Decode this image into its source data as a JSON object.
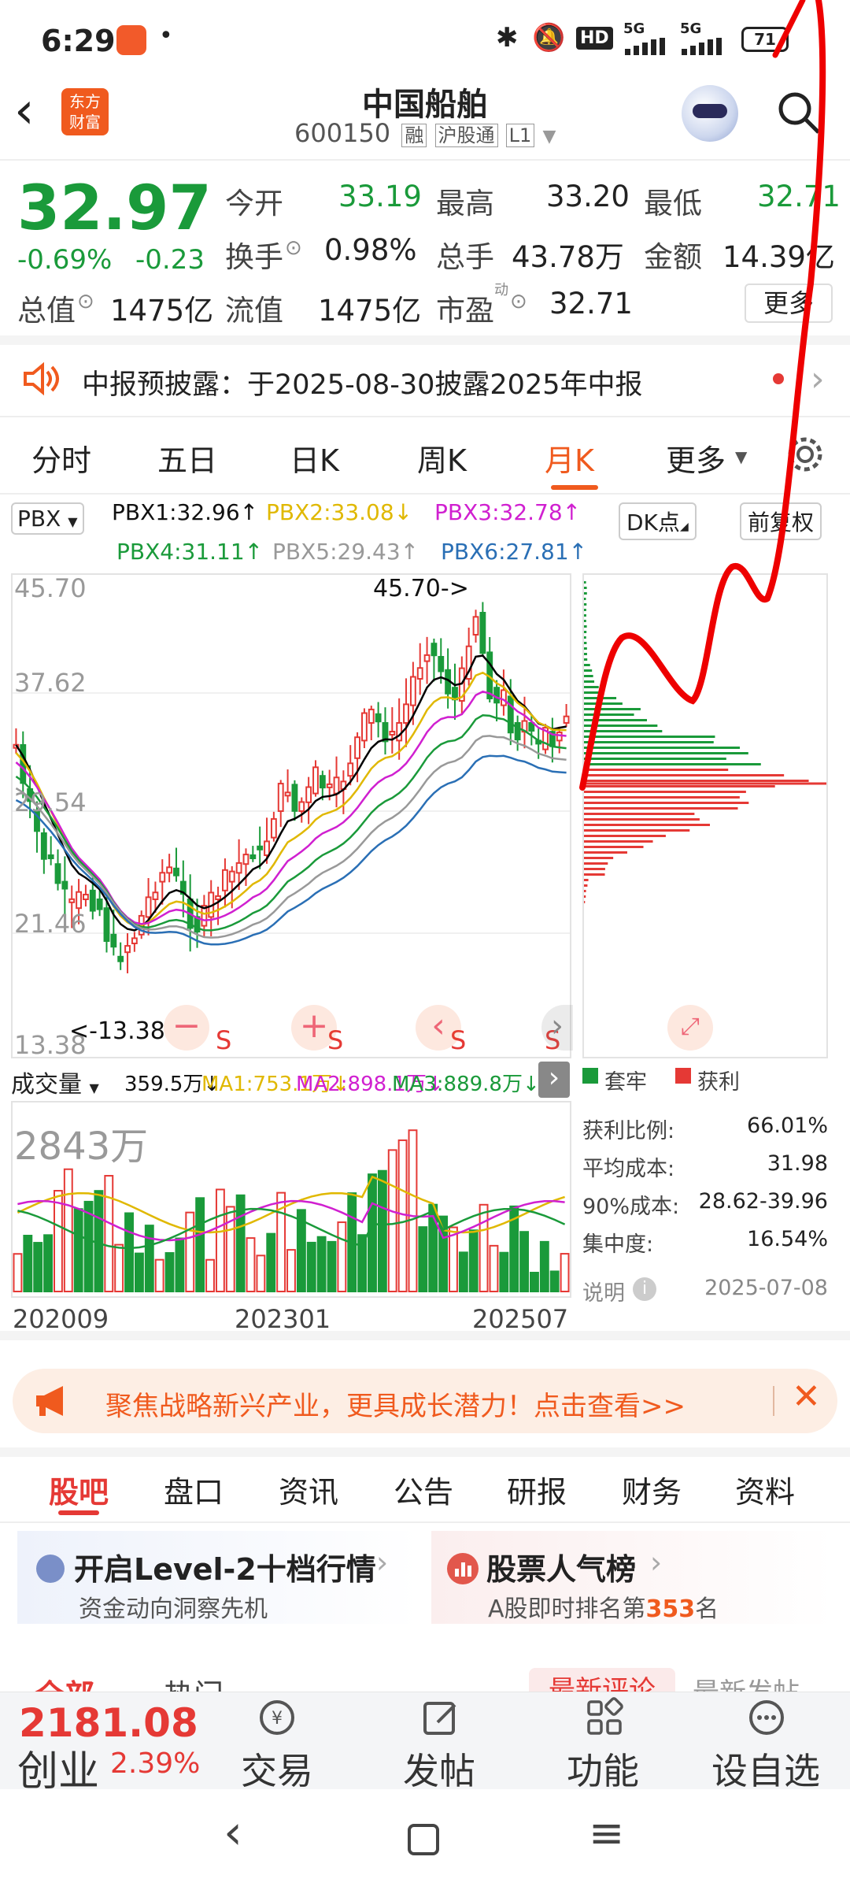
{
  "status": {
    "time": "6:29",
    "battery": "71",
    "net1": "5G",
    "net2": "5G",
    "hd": "HD"
  },
  "header": {
    "title": "中国船舶",
    "code": "600150",
    "tag1": "融",
    "tag2": "沪股通",
    "tag3": "L1",
    "logo_line1": "东方",
    "logo_line2": "财富"
  },
  "quote": {
    "price": "32.97",
    "pct": "-0.69%",
    "chg": "-0.23",
    "l_open": "今开",
    "open": "33.19",
    "l_high": "最高",
    "high": "33.20",
    "l_low": "最低",
    "low": "32.71",
    "l_turn": "换手",
    "turn": "0.98%",
    "l_vol": "总手",
    "vol": "43.78万",
    "l_amt": "金额",
    "amt": "14.39亿",
    "l_cap": "总值",
    "cap": "1475亿",
    "l_float": "流值",
    "float": "1475亿",
    "l_pe": "市盈",
    "pe_sup": "动",
    "pe": "32.71",
    "more": "更多"
  },
  "notice": {
    "text": "中报预披露：于2025-08-30披露2025年中报"
  },
  "tabs": [
    "分时",
    "五日",
    "日K",
    "周K",
    "月K",
    "更多"
  ],
  "active_tab": "月K",
  "indicator": {
    "name": "PBX",
    "pbx1": "PBX1:32.96↑",
    "pbx2": "PBX2:33.08↓",
    "pbx3": "PBX3:32.78↑",
    "pbx4": "PBX4:31.11↑",
    "pbx5": "PBX5:29.43↑",
    "pbx6": "PBX6:27.81↑",
    "dk": "DK点",
    "fq": "前复权"
  },
  "chart": {
    "y_labels": [
      "45.70",
      "37.62",
      "29.54",
      "21.46",
      "13.38"
    ],
    "max_label": "45.70->",
    "min_label": "<-13.38",
    "s_marks": [
      "S",
      "S",
      "S",
      "S"
    ],
    "colors": {
      "up": "#e53935",
      "down": "#1a9a3a",
      "pbx1": "#000000",
      "pbx2": "#e0b800",
      "pbx3": "#d020d0",
      "pbx4": "#1a9a3a",
      "pbx5": "#999999",
      "pbx6": "#2a6fb5"
    }
  },
  "volume": {
    "label": "成交量",
    "vol": "359.5万↓",
    "ma1": "MA1:753.1万↓",
    "ma2": "MA2:898.1万↓",
    "ma3": "MA3:889.8万↓",
    "max": "2843万",
    "x_labels": [
      "202009",
      "202301",
      "202507"
    ]
  },
  "chips": {
    "legend_trap": "套牢",
    "legend_profit": "获利",
    "rows": [
      {
        "k": "获利比例:",
        "v": "66.01%"
      },
      {
        "k": "平均成本:",
        "v": "31.98"
      },
      {
        "k": "90%成本:",
        "v": "28.62-39.96"
      },
      {
        "k": "集中度:",
        "v": "16.54%"
      }
    ],
    "note": "说明",
    "date": "2025-07-08"
  },
  "banner": {
    "text": "聚焦战略新兴产业，更具成长潜力！点击查看>>"
  },
  "sections": [
    "股吧",
    "盘口",
    "资讯",
    "公告",
    "研报",
    "财务",
    "资料"
  ],
  "cards": [
    {
      "title": "开启Level-2十档行情",
      "sub": "资金动向洞察先机"
    },
    {
      "title": "股票人气榜",
      "sub_pre": "A股即时排名第",
      "rank": "353",
      "sub_post": "名"
    }
  ],
  "sub_tabs": {
    "all": "全部",
    "hot": "热门",
    "latest_reply": "最新评论",
    "latest_post": "最新发帖"
  },
  "bottom": {
    "index_val": "2181.08",
    "index_name": "创业",
    "index_pct": "2.39%",
    "trade": "交易",
    "post": "发帖",
    "func": "功能",
    "fav": "设自选"
  }
}
